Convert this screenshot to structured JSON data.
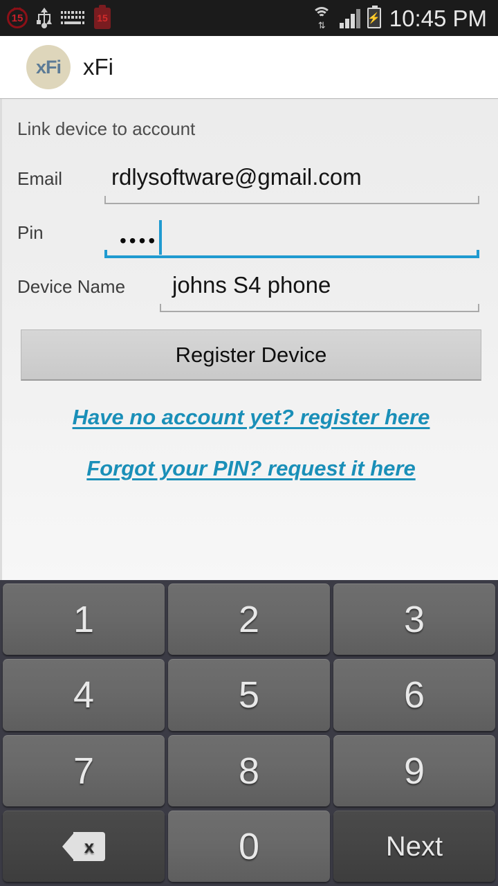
{
  "status_bar": {
    "time": "10:45 PM",
    "alarm_badge": "15",
    "battery_badge": "15",
    "left_icons": [
      "alarm-15-icon",
      "usb-icon",
      "keyboard-icon",
      "battery-low-15-icon"
    ],
    "right_icons": [
      "wifi-icon",
      "cell-signal-icon",
      "battery-charging-icon"
    ],
    "wifi_transfer": "⇅",
    "charging_bolt": "⚡",
    "background": "#1b1b1b"
  },
  "app_bar": {
    "logo_text": "xFi",
    "title": "xFi",
    "logo_background": "#ded6bb",
    "logo_color": "#5c7b96"
  },
  "form": {
    "section_title": "Link device to account",
    "fields": [
      {
        "label": "Email",
        "value": "rdlysoftware@gmail.com",
        "placeholder": "Email",
        "focused": false
      },
      {
        "label": "Pin",
        "value": "••••",
        "placeholder": "Pin",
        "focused": true
      },
      {
        "label": "Device Name",
        "value": "johns S4 phone",
        "placeholder": "Device Name",
        "focused": false
      }
    ],
    "submit_label": "Register Device",
    "links": [
      "Have no account yet? register here",
      "Forgot your PIN? request it here"
    ],
    "accent_color": "#1f9ad0",
    "link_color": "#1a8fb8"
  },
  "keypad": {
    "keys": [
      {
        "label": "1",
        "name": "key-1",
        "style": "light"
      },
      {
        "label": "2",
        "name": "key-2",
        "style": "light"
      },
      {
        "label": "3",
        "name": "key-3",
        "style": "light"
      },
      {
        "label": "4",
        "name": "key-4",
        "style": "light"
      },
      {
        "label": "5",
        "name": "key-5",
        "style": "light"
      },
      {
        "label": "6",
        "name": "key-6",
        "style": "light"
      },
      {
        "label": "7",
        "name": "key-7",
        "style": "light"
      },
      {
        "label": "8",
        "name": "key-8",
        "style": "light"
      },
      {
        "label": "9",
        "name": "key-9",
        "style": "light"
      },
      {
        "label": "",
        "name": "key-backspace",
        "style": "dark"
      },
      {
        "label": "0",
        "name": "key-0",
        "style": "light"
      },
      {
        "label": "Next",
        "name": "key-next",
        "style": "dark"
      }
    ],
    "backspace_glyph": "x",
    "background": "#3b3b45"
  }
}
